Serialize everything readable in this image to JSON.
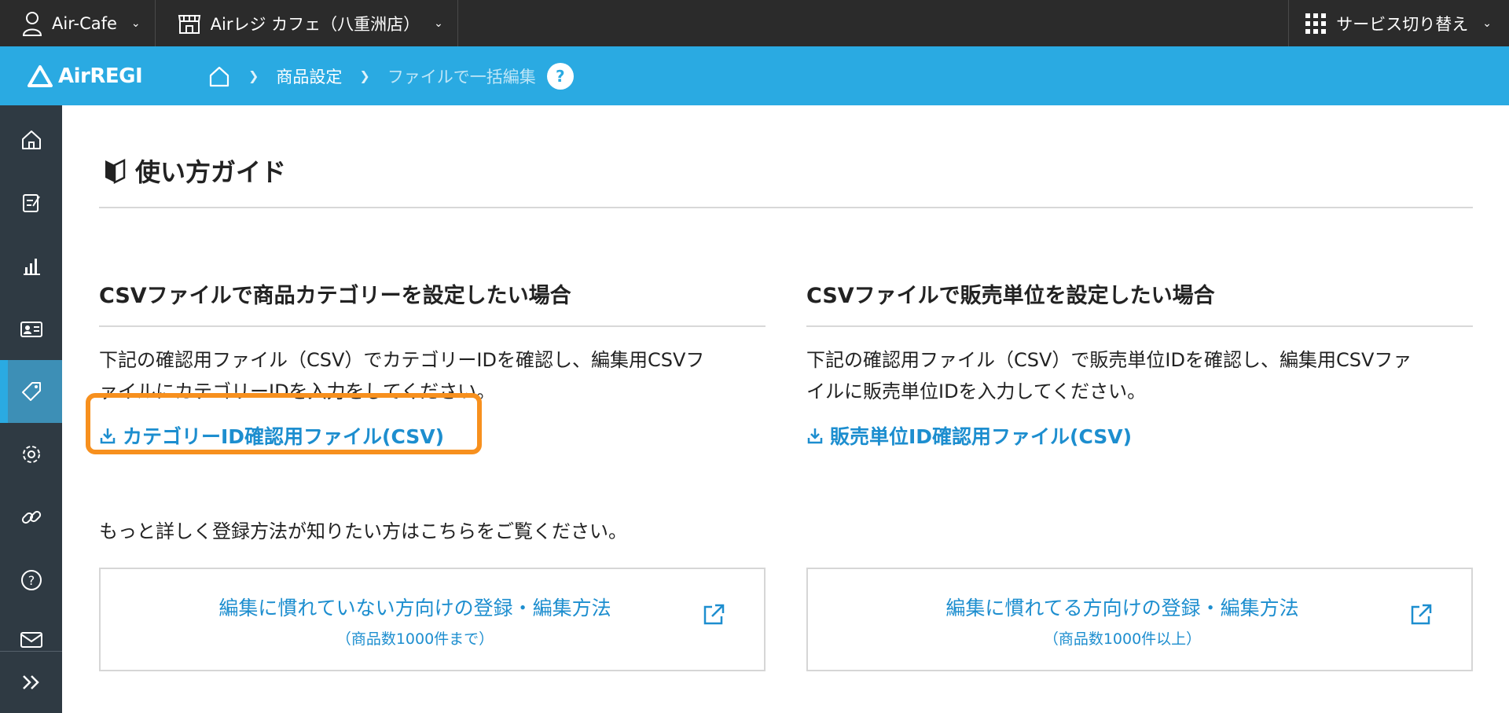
{
  "topbar": {
    "account": "Air-Cafe",
    "store": "Airレジ カフェ（八重洲店）",
    "service_switch": "サービス切り替え"
  },
  "header": {
    "logo": "AirREGI",
    "breadcrumb": [
      "商品設定",
      "ファイルで一括編集"
    ],
    "help": "?"
  },
  "sidebar": {
    "items": [
      "home-icon",
      "order-icon",
      "chart-icon",
      "member-card-icon",
      "tag-icon",
      "gear-icon",
      "link-icon",
      "help-icon",
      "mail-icon"
    ],
    "active_index": 4,
    "expand": "expand-icon"
  },
  "guide": {
    "title": "使い方ガイド"
  },
  "category_section": {
    "title": "CSVファイルで商品カテゴリーを設定したい場合",
    "desc_line1": "下記の確認用ファイル（CSV）でカテゴリーIDを確認し、編集用CSVフ",
    "desc_line2": "ァイルにカテゴリーIDを入力をしてください。",
    "download_link": "カテゴリーID確認用ファイル(CSV)"
  },
  "unit_section": {
    "title": "CSVファイルで販売単位を設定したい場合",
    "desc_line1": "下記の確認用ファイル（CSV）で販売単位IDを確認し、編集用CSVファ",
    "desc_line2": "イルに販売単位IDを入力してください。",
    "download_link": "販売単位ID確認用ファイル(CSV)"
  },
  "more_info": "もっと詳しく登録方法が知りたい方はこちらをご覧ください。",
  "beginner_link": {
    "label": "編集に慣れていない方向けの登録・編集方法",
    "sub": "（商品数1000件まで）"
  },
  "expert_link": {
    "label": "編集に慣れてる方向けの登録・編集方法",
    "sub": "（商品数1000件以上）"
  },
  "colors": {
    "topbar": "#2b2b2b",
    "header": "#2aaae2",
    "sidebar": "#2f3a43",
    "link": "#1d8ecf",
    "highlight": "#f7901e"
  }
}
